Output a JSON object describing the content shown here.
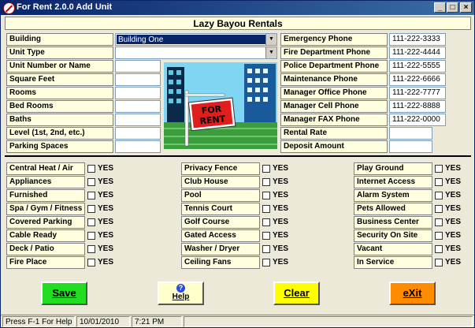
{
  "window": {
    "title": "For Rent  2.0.0   Add Unit"
  },
  "header": {
    "title": "Lazy Bayou Rentals"
  },
  "left_fields": [
    {
      "label": "Building",
      "kind": "select",
      "value": "Building One",
      "active": true
    },
    {
      "label": "Unit Type",
      "kind": "select",
      "value": ""
    },
    {
      "label": "Unit Number or Name",
      "kind": "input",
      "value": ""
    },
    {
      "label": "Square Feet",
      "kind": "input",
      "value": ""
    },
    {
      "label": "Rooms",
      "kind": "input",
      "value": ""
    },
    {
      "label": "Bed Rooms",
      "kind": "input",
      "value": ""
    },
    {
      "label": "Baths",
      "kind": "input",
      "value": ""
    },
    {
      "label": "Level (1st, 2nd, etc.)",
      "kind": "input",
      "value": ""
    },
    {
      "label": "Parking Spaces",
      "kind": "input",
      "value": ""
    }
  ],
  "sign_image": {
    "text_line1": "FOR",
    "text_line2": "RENT"
  },
  "right_fields": [
    {
      "label": "Emergency Phone",
      "value": "111-222-3333"
    },
    {
      "label": "Fire Department Phone",
      "value": "111-222-4444"
    },
    {
      "label": "Police Department Phone",
      "value": "111-222-5555"
    },
    {
      "label": "Maintenance Phone",
      "value": "111-222-6666"
    },
    {
      "label": "Manager Office Phone",
      "value": "111-222-7777"
    },
    {
      "label": "Manager Cell Phone",
      "value": "111-222-8888"
    },
    {
      "label": "Manager FAX Phone",
      "value": "111-222-0000"
    },
    {
      "label": "Rental Rate",
      "value": ""
    },
    {
      "label": "Deposit Amount",
      "value": ""
    }
  ],
  "amenities": {
    "yes_label": "YES",
    "col1": [
      "Central Heat / Air",
      "Appliances",
      "Furnished",
      "Spa / Gym / Fitness",
      "Covered Parking",
      "Cable Ready",
      "Deck / Patio",
      "Fire Place"
    ],
    "col2": [
      "Privacy Fence",
      "Club House",
      "Pool",
      "Tennis Court",
      "Golf Course",
      "Gated Access",
      "Washer / Dryer",
      "Ceiling Fans"
    ],
    "col3": [
      "Play Ground",
      "Internet Access",
      "Alarm System",
      "Pets Allowed",
      "Business Center",
      "Security On Site",
      "Vacant",
      "In Service"
    ]
  },
  "buttons": {
    "save": {
      "label": "Save",
      "color": "#22dd22"
    },
    "help": {
      "label": "Help",
      "color": "#ffffcc"
    },
    "clear": {
      "label": "Clear",
      "color": "#ffff00"
    },
    "exit": {
      "label": "eXit",
      "color": "#ff8c00"
    }
  },
  "status": {
    "help_text": "Press F-1 For Help",
    "date": "10/01/2010",
    "time": "7:21 PM"
  }
}
